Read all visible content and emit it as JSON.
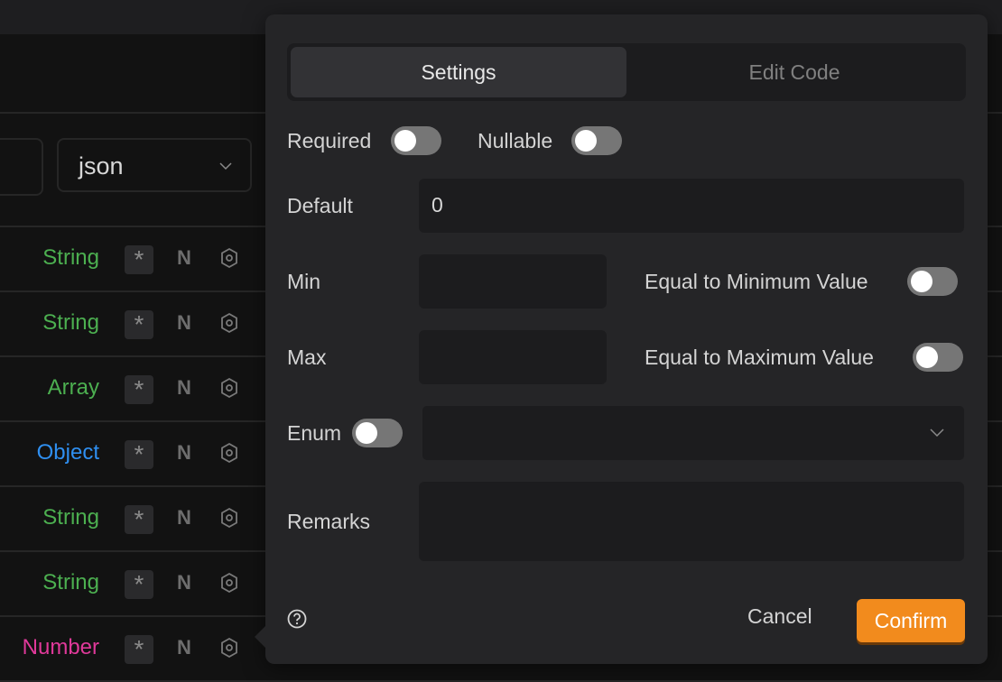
{
  "background": {
    "format_select": {
      "value": "json"
    },
    "rows": [
      {
        "type": "String",
        "type_color": "#4caf50",
        "required_icon": "asterisk-icon",
        "nullable_label": "N",
        "settings_icon": "hexagon-settings-icon"
      },
      {
        "type": "String",
        "type_color": "#4caf50",
        "required_icon": "asterisk-icon",
        "nullable_label": "N",
        "settings_icon": "hexagon-settings-icon"
      },
      {
        "type": "Array",
        "type_color": "#4caf50",
        "required_icon": "asterisk-icon",
        "nullable_label": "N",
        "settings_icon": "hexagon-settings-icon"
      },
      {
        "type": "Object",
        "type_color": "#2f8ff0",
        "required_icon": "asterisk-icon",
        "nullable_label": "N",
        "settings_icon": "hexagon-settings-icon"
      },
      {
        "type": "String",
        "type_color": "#4caf50",
        "required_icon": "asterisk-icon",
        "nullable_label": "N",
        "settings_icon": "hexagon-settings-icon"
      },
      {
        "type": "String",
        "type_color": "#4caf50",
        "required_icon": "asterisk-icon",
        "nullable_label": "N",
        "settings_icon": "hexagon-settings-icon"
      },
      {
        "type": "Number",
        "type_color": "#e0399a",
        "required_icon": "asterisk-icon",
        "nullable_label": "N",
        "settings_icon": "hexagon-settings-icon"
      }
    ]
  },
  "popover": {
    "tabs": [
      {
        "label": "Settings",
        "active": true
      },
      {
        "label": "Edit Code",
        "active": false
      }
    ],
    "required": {
      "label": "Required",
      "on": false
    },
    "nullable": {
      "label": "Nullable",
      "on": false
    },
    "default": {
      "label": "Default",
      "value": "0"
    },
    "min": {
      "label": "Min",
      "value": ""
    },
    "max": {
      "label": "Max",
      "value": ""
    },
    "equal_min": {
      "label": "Equal to Minimum Value",
      "on": false
    },
    "equal_max": {
      "label": "Equal to Maximum Value",
      "on": false
    },
    "enum": {
      "label": "Enum",
      "on": false,
      "value": ""
    },
    "remarks": {
      "label": "Remarks",
      "value": ""
    },
    "help_icon": "question-circle-icon",
    "cancel_label": "Cancel",
    "confirm_label": "Confirm",
    "accent_color": "#f28b1d"
  }
}
